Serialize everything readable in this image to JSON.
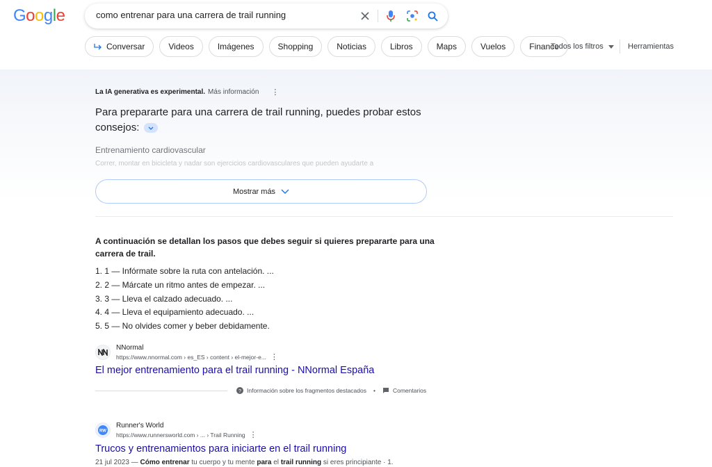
{
  "logo": {
    "letters": [
      "G",
      "o",
      "o",
      "g",
      "l",
      "e"
    ],
    "colors": [
      "#4285f4",
      "#ea4335",
      "#fbbc05",
      "#4285f4",
      "#34a853",
      "#ea4335"
    ]
  },
  "search": {
    "query": "como entrenar para una carrera de trail running"
  },
  "chips": [
    "Conversar",
    "Videos",
    "Imágenes",
    "Shopping",
    "Noticias",
    "Libros",
    "Maps",
    "Vuelos",
    "Finance"
  ],
  "filters": {
    "all_filters": "Todos los filtros",
    "tools": "Herramientas"
  },
  "ai": {
    "label_bold": "La IA generativa es experimental.",
    "label_more": "Más información",
    "heading": "Para prepararte para una carrera de trail running, puedes probar estos consejos:",
    "subheading": "Entrenamiento cardiovascular",
    "faded_text": "Correr, montar en bicicleta y nadar son ejercicios cardiovasculares que pueden ayudarte a",
    "show_more": "Mostrar más"
  },
  "featured": {
    "title": "A continuación se detallan los pasos que debes seguir si quieres prepararte para una carrera de trail.",
    "steps": [
      "1. 1 — Infórmate sobre la ruta con antelación. ...",
      "2. 2 — Márcate un ritmo antes de empezar. ...",
      "3. 3 — Lleva el calzado adecuado. ...",
      "4. 4 — Lleva el equipamiento adecuado. ...",
      "5. 5 — No olvides comer y beber debidamente."
    ],
    "source_name": "NNormal",
    "source_url": "https://www.nnormal.com › es_ES › content › el-mejor-e...",
    "link": "El mejor entrenamiento para el trail running - NNormal España",
    "about_snippets": "Información sobre los fragmentos destacados",
    "feedback": "Comentarios"
  },
  "result2": {
    "source_name": "Runner's World",
    "source_url": "https://www.runnersworld.com › ... › Trail Running",
    "link": "Trucos y entrenamientos para iniciarte en el trail running",
    "date": "21 jul 2023",
    "snippet_parts": [
      "Cómo entrenar",
      " tu cuerpo y tu mente ",
      "para",
      " el ",
      "trail running",
      " si eres principiante · 1."
    ]
  }
}
